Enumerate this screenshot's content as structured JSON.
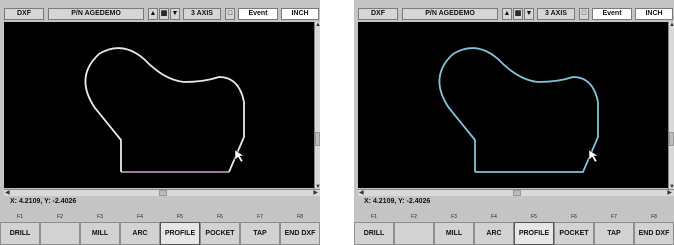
{
  "panels": [
    {
      "toolbar": {
        "mode": "DXF",
        "part": "P/N AGEDEMO",
        "axis": "3 AXIS",
        "event": "Event",
        "units": "INCH"
      },
      "coords": "X: 4.2109, Y: -2.4026",
      "fkeys": [
        "F1",
        "F2",
        "F3",
        "F4",
        "F5",
        "F6",
        "F7",
        "F8"
      ],
      "softkeys": [
        "DRILL",
        "",
        "MILL",
        "ARC",
        "PROFILE",
        "POCKET",
        "TAP",
        "END DXF"
      ],
      "profile_color": "#e8e8e8",
      "bottom_edge_color": "#d9a4cf"
    },
    {
      "toolbar": {
        "mode": "DXF",
        "part": "P/N AGEDEMO",
        "axis": "3 AXIS",
        "event": "Event",
        "units": "INCH"
      },
      "coords": "X: 4.2109, Y: -2.4026",
      "fkeys": [
        "F1",
        "F2",
        "F3",
        "F4",
        "F5",
        "F6",
        "F7",
        "F8"
      ],
      "softkeys": [
        "DRILL",
        "",
        "MILL",
        "ARC",
        "PROFILE",
        "POCKET",
        "TAP",
        "END DXF"
      ],
      "profile_color": "#7fc4d8",
      "bottom_edge_color": "#7fc4d8"
    }
  ],
  "icons": {
    "up": "up-arrow-icon",
    "down": "down-arrow-icon",
    "grid": "grid-icon",
    "small_box": "small-box-icon",
    "cursor": "mouse-cursor-icon"
  }
}
